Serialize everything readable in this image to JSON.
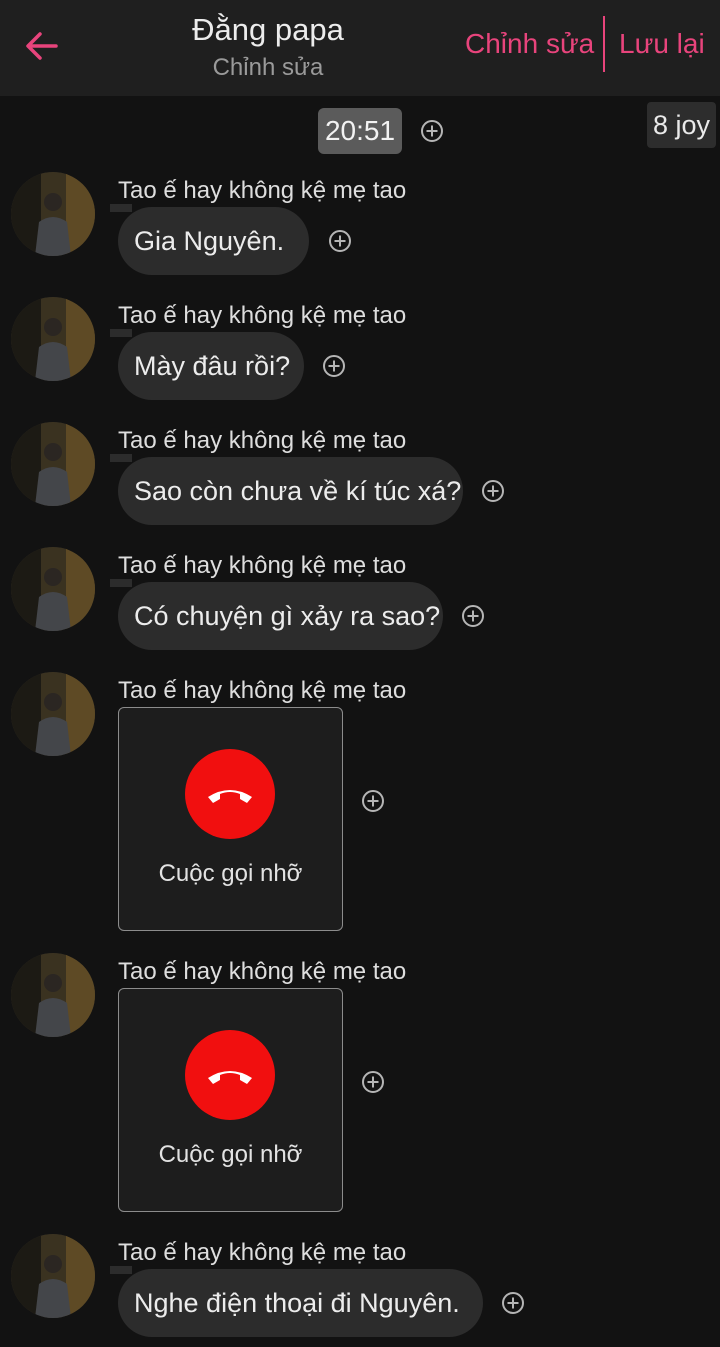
{
  "header": {
    "title": "Đằng papa",
    "subtitle": "Chỉnh sửa",
    "edit_label": "Chỉnh sửa",
    "save_label": "Lưu lại",
    "accent_color": "#e8447c"
  },
  "timestamp": "20:51",
  "badge": "8 joy",
  "messages": [
    {
      "sender": "Tao ế hay không kệ mẹ tao",
      "type": "text",
      "text": "Gia Nguyên."
    },
    {
      "sender": "Tao ế hay không kệ mẹ tao",
      "type": "text",
      "text": "Mày đâu rồi?"
    },
    {
      "sender": "Tao ế hay không kệ mẹ tao",
      "type": "text",
      "text": "Sao còn chưa về kí túc xá?"
    },
    {
      "sender": "Tao ế hay không kệ mẹ tao",
      "type": "text",
      "text": "Có chuyện gì xảy ra sao?"
    },
    {
      "sender": "Tao ế hay không kệ mẹ tao",
      "type": "call",
      "text": "Cuộc gọi nhỡ"
    },
    {
      "sender": "Tao ế hay không kệ mẹ tao",
      "type": "call",
      "text": "Cuộc gọi nhỡ"
    },
    {
      "sender": "Tao ế hay không kệ mẹ tao",
      "type": "text",
      "text": "Nghe điện thoại đi Nguyên."
    }
  ],
  "icons": {
    "back": "arrow-left-icon",
    "add": "plus-circle-icon",
    "missed_call": "phone-hangup-icon"
  },
  "colors": {
    "background": "#121212",
    "bubble": "#2c2c2c",
    "missed_call": "#f10f0f"
  }
}
